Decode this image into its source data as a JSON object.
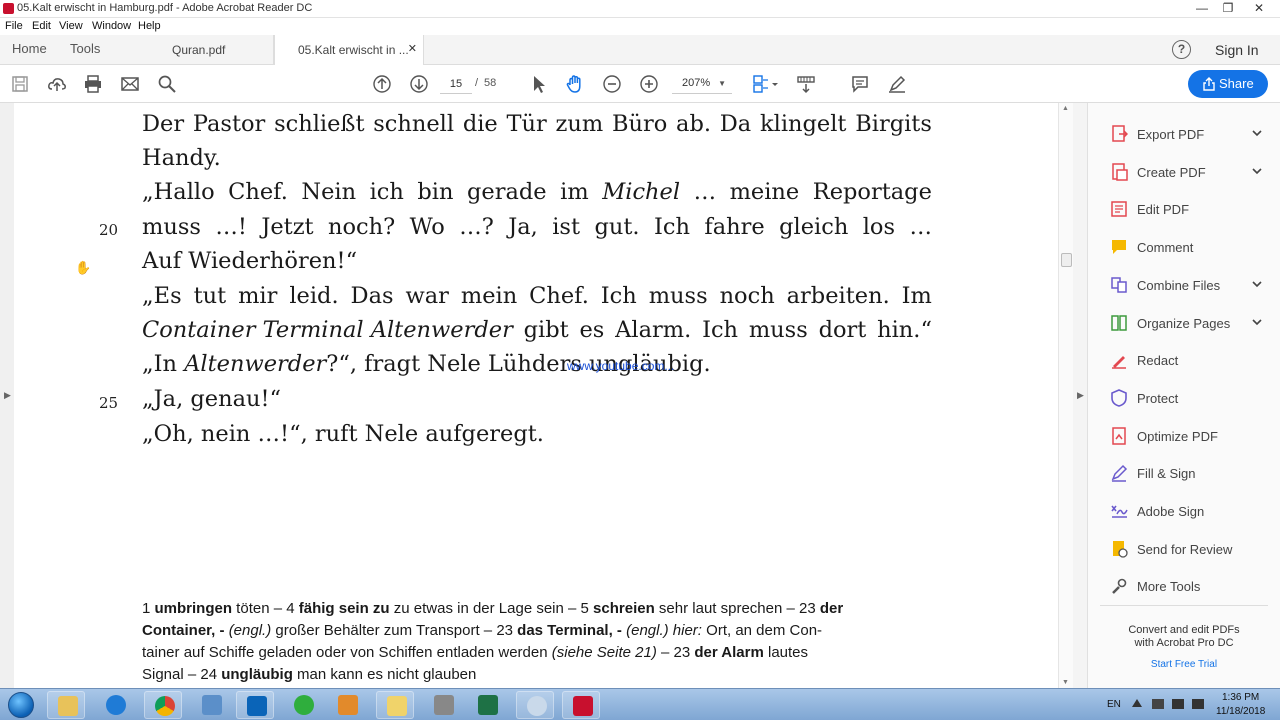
{
  "window": {
    "title": "05.Kalt erwischt in Hamburg.pdf - Adobe Acrobat Reader DC",
    "controls": {
      "minimize": "—",
      "maximize": "❐",
      "close": "✕"
    }
  },
  "menu": {
    "file": "File",
    "edit": "Edit",
    "view": "View",
    "window": "Window",
    "help": "Help"
  },
  "tabs": {
    "home": "Home",
    "tools": "Tools",
    "doc1": "Quran.pdf",
    "doc2": "05.Kalt erwischt in ...",
    "close": "✕",
    "help": "?",
    "signin": "Sign In"
  },
  "toolbar": {
    "page_current": "15",
    "page_sep": "/",
    "page_total": "58",
    "zoom": "207%",
    "share": "Share"
  },
  "document": {
    "lines": [
      [
        "Der",
        "Pastor",
        "schließt",
        "schnell",
        "die",
        "Tür",
        "zum",
        "Büro",
        "ab.",
        "Da",
        "klingelt",
        "Birgits"
      ],
      "Handy.",
      [
        "„Hallo",
        "Chef.",
        "Nein",
        "ich",
        "bin",
        "gerade",
        "im",
        "Michel",
        "…",
        "meine",
        "Reportage"
      ],
      [
        "muss",
        "…!",
        "Jetzt",
        "noch?",
        "Wo",
        "…?",
        "Ja,",
        "ist",
        "gut.",
        "Ich",
        "fahre",
        "gleich",
        "los",
        "…"
      ],
      "Auf Wiederhören!“",
      [
        "„Es",
        "tut",
        "mir",
        "leid.",
        "Das",
        "war",
        "mein",
        "Chef.",
        "Ich",
        "muss",
        "noch",
        "arbeiten.",
        "Im"
      ],
      [
        "Container Terminal Altenwerder",
        "gibt",
        "es",
        "Alarm.",
        "Ich",
        "muss",
        "dort",
        "hin.“"
      ],
      [
        "„In ",
        "Altenwerder",
        "?“, fragt Nele Lühders ungläubig."
      ],
      "„Ja, genau!“",
      "„Oh, nein …!“, ruft Nele aufgeregt."
    ],
    "line_numbers": [
      "20",
      "25"
    ],
    "watermark": "www.youtube.com...",
    "footnotes": [
      [
        [
          "1 ",
          false
        ],
        [
          "umbringen",
          true
        ],
        [
          " töten – 4 ",
          false
        ],
        [
          "fähig sein zu",
          true
        ],
        [
          " zu etwas in der Lage sein – 5 ",
          false
        ],
        [
          "schreien",
          true
        ],
        [
          " sehr laut sprechen – 23 ",
          false
        ],
        [
          "der",
          true
        ]
      ],
      [
        [
          "Container, -",
          true
        ],
        [
          " ",
          false
        ],
        [
          "(engl.)",
          false,
          true
        ],
        [
          " großer Behälter zum Transport – 23 ",
          false
        ],
        [
          "das Terminal, -",
          true
        ],
        [
          " ",
          false
        ],
        [
          "(engl.) hier:",
          false,
          true
        ],
        [
          " Ort, an dem Con-",
          false
        ]
      ],
      [
        [
          "tainer auf Schiffe geladen oder von Schiffen entladen werden ",
          false
        ],
        [
          "(siehe Seite 21)",
          false,
          true
        ],
        [
          " – 23 ",
          false
        ],
        [
          "der Alarm",
          true
        ],
        [
          " lautes",
          false
        ]
      ],
      [
        [
          "Signal – 24 ",
          false
        ],
        [
          "ungläubig",
          true
        ],
        [
          " man kann es nicht glauben",
          false
        ]
      ]
    ]
  },
  "right_pane": {
    "tools": [
      {
        "label": "Export PDF",
        "icon": "export-pdf-icon",
        "color": "#e34850",
        "chevron": true
      },
      {
        "label": "Create PDF",
        "icon": "create-pdf-icon",
        "color": "#e34850",
        "chevron": true
      },
      {
        "label": "Edit PDF",
        "icon": "edit-pdf-icon",
        "color": "#e34850",
        "chevron": false
      },
      {
        "label": "Comment",
        "icon": "comment-icon",
        "color": "#f5b800",
        "chevron": false
      },
      {
        "label": "Combine Files",
        "icon": "combine-files-icon",
        "color": "#6a5acd",
        "chevron": true
      },
      {
        "label": "Organize Pages",
        "icon": "organize-pages-icon",
        "color": "#3c9a3c",
        "chevron": true
      },
      {
        "label": "Redact",
        "icon": "redact-icon",
        "color": "#e34850",
        "chevron": false
      },
      {
        "label": "Protect",
        "icon": "protect-icon",
        "color": "#6a5acd",
        "chevron": false
      },
      {
        "label": "Optimize PDF",
        "icon": "optimize-pdf-icon",
        "color": "#e34850",
        "chevron": false
      },
      {
        "label": "Fill & Sign",
        "icon": "fill-sign-icon",
        "color": "#6a5acd",
        "chevron": false
      },
      {
        "label": "Adobe Sign",
        "icon": "adobe-sign-icon",
        "color": "#6a5acd",
        "chevron": false
      },
      {
        "label": "Send for Review",
        "icon": "send-for-review-icon",
        "color": "#f5b800",
        "chevron": false
      },
      {
        "label": "More Tools",
        "icon": "more-tools-icon",
        "color": "#555555",
        "chevron": false
      }
    ],
    "promo": "Convert and edit PDFs\nwith Acrobat Pro DC",
    "trial": "Start Free Trial"
  },
  "taskbar": {
    "lang": "EN",
    "time": "1:36 PM",
    "date": "11/18/2018"
  },
  "colors": {
    "accent": "#1473e6",
    "adobe_red": "#c8102e"
  }
}
